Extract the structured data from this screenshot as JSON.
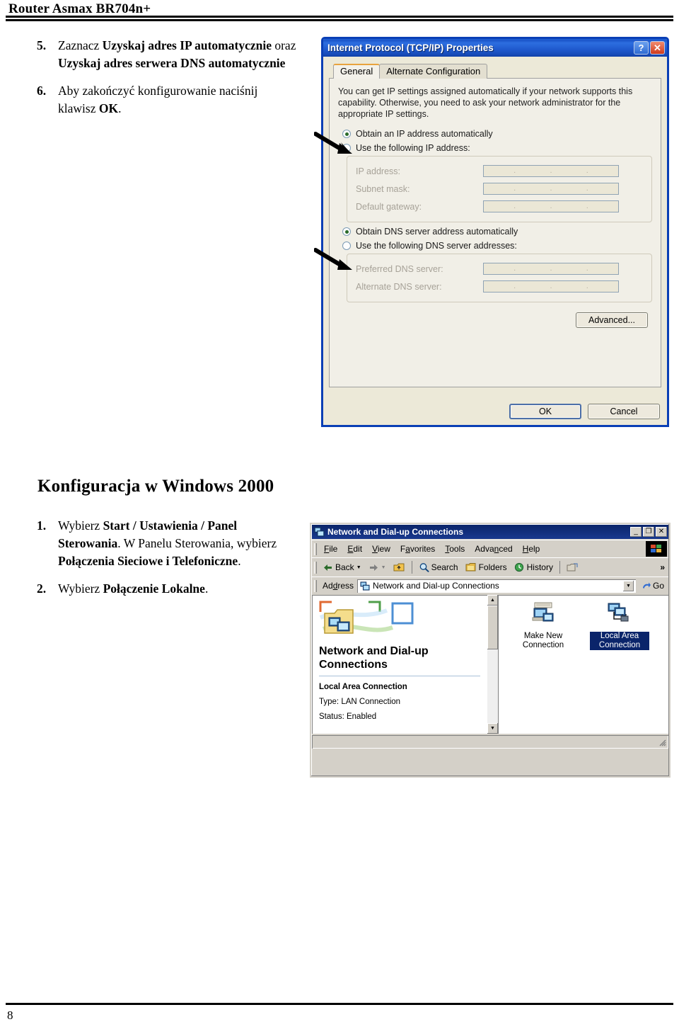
{
  "page": {
    "header_title": "Router Asmax BR704n+",
    "footer_page_number": "8"
  },
  "instructions_xp": {
    "steps": [
      {
        "number": "5.",
        "parts": [
          {
            "text": "Zaznacz ",
            "bold": false
          },
          {
            "text": "Uzyskaj adres IP automatycznie",
            "bold": true
          },
          {
            "text": " oraz ",
            "bold": false
          },
          {
            "text": "Uzyskaj adres serwera DNS automatycznie",
            "bold": true
          }
        ]
      },
      {
        "number": "6.",
        "parts": [
          {
            "text": "Aby zakończyć konfigurowanie naciśnij klawisz ",
            "bold": false
          },
          {
            "text": "OK",
            "bold": true
          },
          {
            "text": ".",
            "bold": false
          }
        ]
      }
    ]
  },
  "section": {
    "heading": "Konfiguracja w Windows 2000"
  },
  "instructions_w2k": {
    "steps": [
      {
        "number": "1.",
        "parts": [
          {
            "text": "Wybierz ",
            "bold": false
          },
          {
            "text": "Start / Ustawienia / Panel Sterowania",
            "bold": true
          },
          {
            "text": ". W Panelu Sterowania, wybierz ",
            "bold": false
          },
          {
            "text": "Połączenia Sieciowe i Telefoniczne",
            "bold": true
          },
          {
            "text": ".",
            "bold": false
          }
        ]
      },
      {
        "number": "2.",
        "parts": [
          {
            "text": "Wybierz ",
            "bold": false
          },
          {
            "text": "Połączenie Lokalne",
            "bold": true
          },
          {
            "text": ".",
            "bold": false
          }
        ]
      }
    ]
  },
  "tcpip_dialog": {
    "title": "Internet Protocol (TCP/IP) Properties",
    "help_button": "?",
    "close_button": "✕",
    "tabs": [
      {
        "label": "General",
        "active": true
      },
      {
        "label": "Alternate Configuration",
        "active": false
      }
    ],
    "intro_text": "You can get IP settings assigned automatically if your network supports this capability. Otherwise, you need to ask your network administrator for the appropriate IP settings.",
    "radio_obtain_ip": {
      "label": "Obtain an IP address automatically",
      "selected": true
    },
    "radio_use_ip": {
      "label": "Use the following IP address:",
      "selected": false
    },
    "ip_fields": [
      {
        "label": "IP address:",
        "value": ".    .    ."
      },
      {
        "label": "Subnet mask:",
        "value": ".    .    ."
      },
      {
        "label": "Default gateway:",
        "value": ".    .    ."
      }
    ],
    "radio_obtain_dns": {
      "label": "Obtain DNS server address automatically",
      "selected": true
    },
    "radio_use_dns": {
      "label": "Use the following DNS server addresses:",
      "selected": false
    },
    "dns_fields": [
      {
        "label": "Preferred DNS server:",
        "value": ".    .    ."
      },
      {
        "label": "Alternate DNS server:",
        "value": ".    .    ."
      }
    ],
    "advanced_button": "Advanced...",
    "ok_button": "OK",
    "cancel_button": "Cancel",
    "accent_title_color": "#1e58cc",
    "active_tab_accent": "#e8a33d"
  },
  "network_window": {
    "title": "Network and Dial-up Connections",
    "minimize_button": "_",
    "maximize_button": "❐",
    "close_button": "✕",
    "menus": [
      {
        "label": "File",
        "accel": "F"
      },
      {
        "label": "Edit",
        "accel": "E"
      },
      {
        "label": "View",
        "accel": "V"
      },
      {
        "label": "Favorites",
        "accel": "a"
      },
      {
        "label": "Tools",
        "accel": "T"
      },
      {
        "label": "Advanced",
        "accel": "n"
      },
      {
        "label": "Help",
        "accel": "H"
      }
    ],
    "toolbar": [
      {
        "label": "Back",
        "icon": "back-arrow-icon"
      },
      {
        "label": "",
        "icon": "forward-arrow-icon"
      },
      {
        "label": "",
        "icon": "up-folder-icon"
      },
      {
        "label": "Search",
        "icon": "search-icon"
      },
      {
        "label": "Folders",
        "icon": "folders-icon"
      },
      {
        "label": "History",
        "icon": "history-icon"
      },
      {
        "label": "",
        "icon": "move-to-folder-icon"
      }
    ],
    "toolbar_overflow": "»",
    "address_label": "Address",
    "address_value": "Network and Dial-up Connections",
    "go_label": "Go",
    "left_pane": {
      "heading": "Network and Dial-up Connections",
      "connection_name": "Local Area Connection",
      "type_line": "Type: LAN Connection",
      "status_line": "Status: Enabled"
    },
    "items": [
      {
        "label": "Make New Connection",
        "selected": false,
        "icon": "make-new-connection-icon"
      },
      {
        "label": "Local Area Connection",
        "selected": true,
        "icon": "lan-connection-icon"
      }
    ],
    "selection_color": "#0a246a",
    "titlebar_color": "#0a246a"
  }
}
